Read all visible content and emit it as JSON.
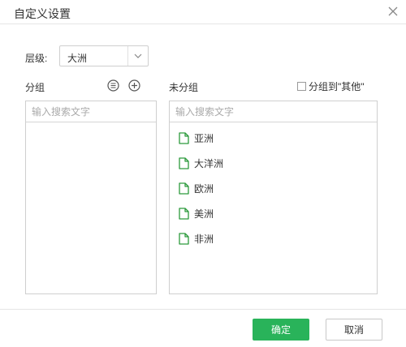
{
  "dialog": {
    "title": "自定义设置"
  },
  "level": {
    "label": "层级:",
    "value": "大洲"
  },
  "grouped": {
    "label": "分组",
    "search_placeholder": "输入搜索文字",
    "items": []
  },
  "ungrouped": {
    "label": "未分组",
    "checkbox_label": "分组到\"其他\"",
    "checkbox_checked": false,
    "search_placeholder": "输入搜索文字",
    "items": [
      {
        "label": "亚洲",
        "icon": "document-icon"
      },
      {
        "label": "大洋洲",
        "icon": "document-icon"
      },
      {
        "label": "欧洲",
        "icon": "document-icon"
      },
      {
        "label": "美洲",
        "icon": "document-icon"
      },
      {
        "label": "非洲",
        "icon": "document-icon"
      }
    ]
  },
  "footer": {
    "ok_label": "确定",
    "cancel_label": "取消"
  },
  "colors": {
    "accent": "#29b35a",
    "icon_green": "#2c9a3c",
    "border": "#cfcfcf"
  }
}
